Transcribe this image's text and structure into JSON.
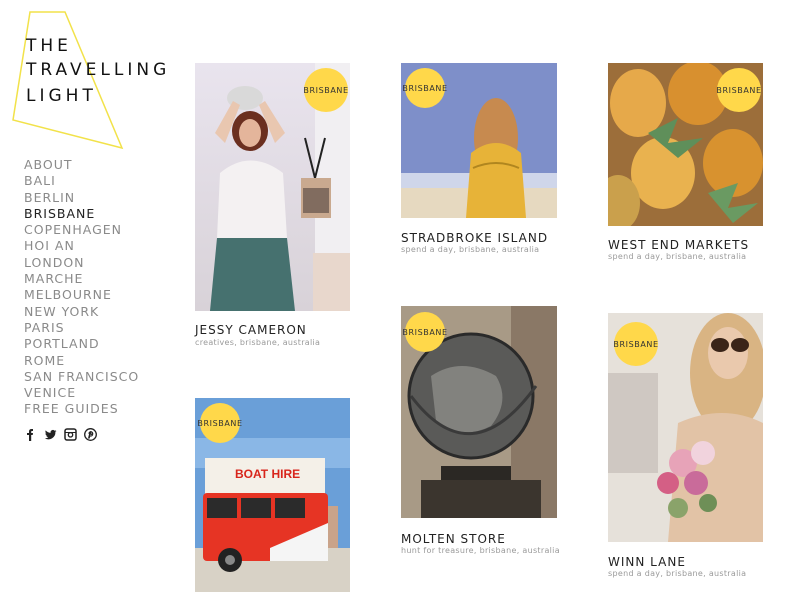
{
  "logo": {
    "line1": "THE",
    "line2": "TRAVELLING",
    "line3": "LIGHT"
  },
  "nav": [
    "ABOUT",
    "BALI",
    "BERLIN",
    "BRISBANE",
    "COPENHAGEN",
    "HOI AN",
    "LONDON",
    "MARCHE",
    "MELBOURNE",
    "NEW YORK",
    "PARIS",
    "PORTLAND",
    "ROME",
    "SAN FRANCISCO",
    "VENICE",
    "FREE GUIDES"
  ],
  "social": [
    "facebook-icon",
    "twitter-icon",
    "instagram-icon",
    "pinterest-icon"
  ],
  "badge": "BRISBANE",
  "cards": {
    "jessy": {
      "title": "JESSY CAMERON",
      "sub": "creatives, brisbane, australia"
    },
    "boat": {
      "title": "",
      "sub": ""
    },
    "stradbroke": {
      "title": "STRADBROKE ISLAND",
      "sub": "spend a day, brisbane, australia"
    },
    "molten": {
      "title": "MOLTEN STORE",
      "sub": "hunt for treasure, brisbane, australia"
    },
    "westend": {
      "title": "WEST END MARKETS",
      "sub": "spend a day, brisbane, australia"
    },
    "winn": {
      "title": "WINN LANE",
      "sub": "spend a day, brisbane, australia"
    }
  },
  "colors": {
    "accent": "#ffd84a",
    "nav_active": "#222222",
    "nav": "#8a8a8a"
  }
}
